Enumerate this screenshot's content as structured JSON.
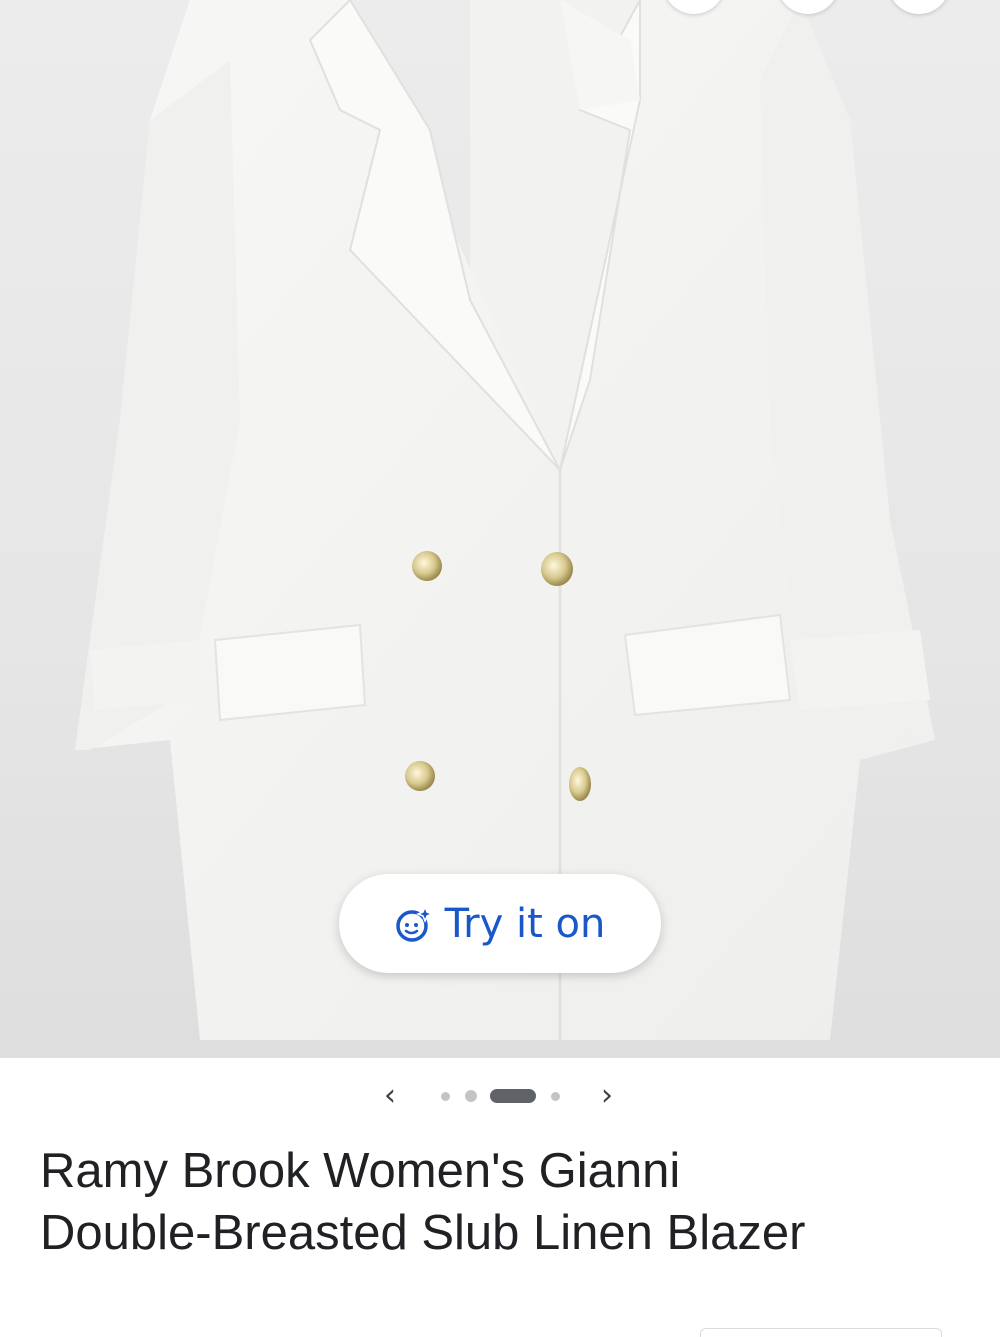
{
  "product": {
    "try_on_label": "Try it on",
    "title_line1": "Ramy Brook Women's Gianni",
    "title_line2": "Double-Breasted Slub Linen Blazer"
  },
  "gallery": {
    "prev_glyph": "‹",
    "next_glyph": "›",
    "active_index": 2,
    "dot_count": 4
  },
  "icons": {
    "try_on": "face-sparkle-icon",
    "prev": "chevron-left-icon",
    "next": "chevron-right-icon"
  },
  "colors": {
    "accent": "#1a57c8",
    "page_bg": "#ffffff",
    "text": "#202124",
    "dot_active": "#5f6368",
    "dot_inactive": "#c4c4c4"
  }
}
